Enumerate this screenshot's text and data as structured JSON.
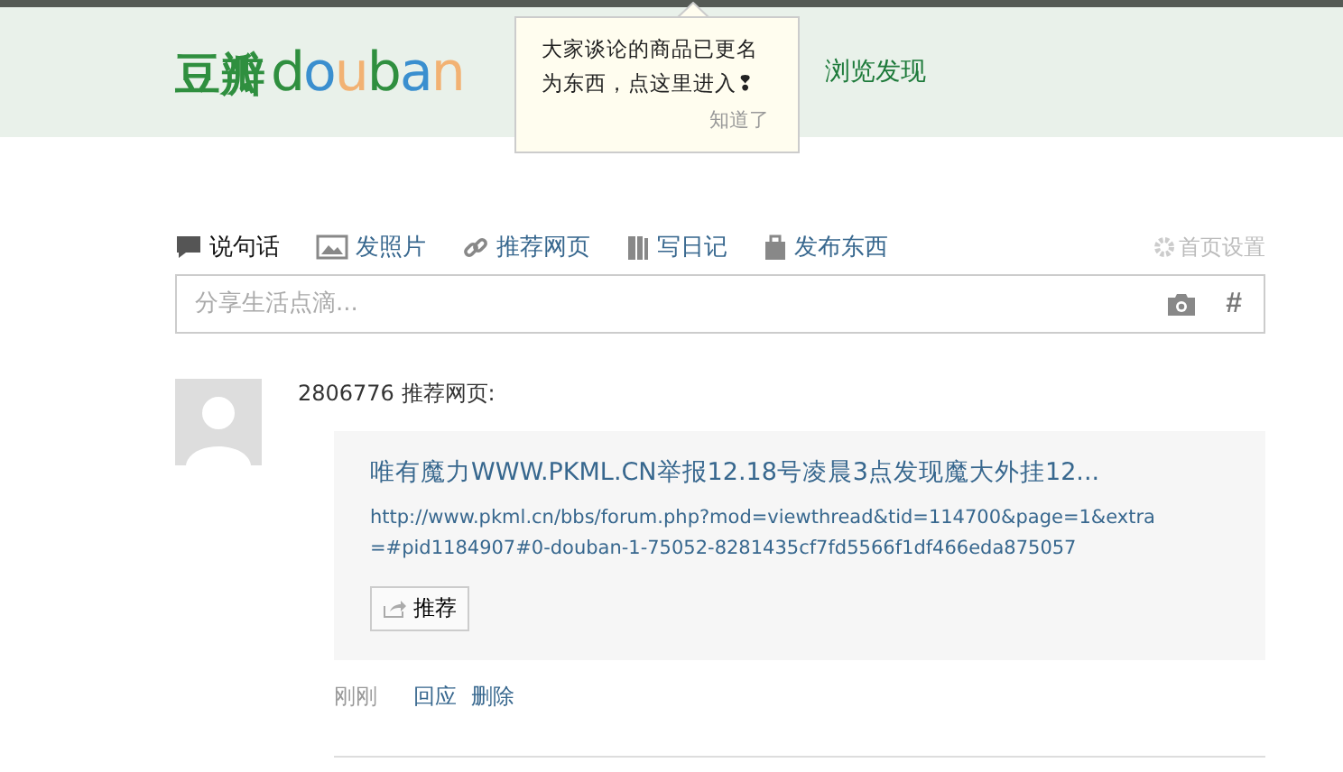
{
  "header": {
    "logo_cn": "豆瓣",
    "logo_en": "douban",
    "nav": [
      "浏览发现"
    ]
  },
  "tooltip": {
    "message": "大家谈论的商品已更名为东西，点这里进入❢",
    "dismiss": "知道了"
  },
  "composer": {
    "tabs": [
      {
        "label": "说句话",
        "kind": "speech",
        "selected": true
      },
      {
        "label": "发照片",
        "kind": "photo",
        "selected": false
      },
      {
        "label": "推荐网页",
        "kind": "link",
        "selected": false
      },
      {
        "label": "写日记",
        "kind": "diary",
        "selected": false
      },
      {
        "label": "发布东西",
        "kind": "bag",
        "selected": false
      }
    ],
    "settings": "首页设置",
    "placeholder": "分享生活点滴...",
    "hashtag": "#"
  },
  "feed": [
    {
      "user": "2806776 推荐网页:",
      "title": "唯有魔力WWW.PKML.CN举报12.18号凌晨3点发现魔大外挂12...",
      "url": "http://www.pkml.cn/bbs/forum.php?mod=viewthread&tid=114700&page=1&extra=#pid1184907#0-douban-1-75052-8281435cf7fd5566f1df466eda875057",
      "recommend": "推荐",
      "time": "刚刚",
      "actions": [
        "回应",
        "删除"
      ]
    }
  ]
}
